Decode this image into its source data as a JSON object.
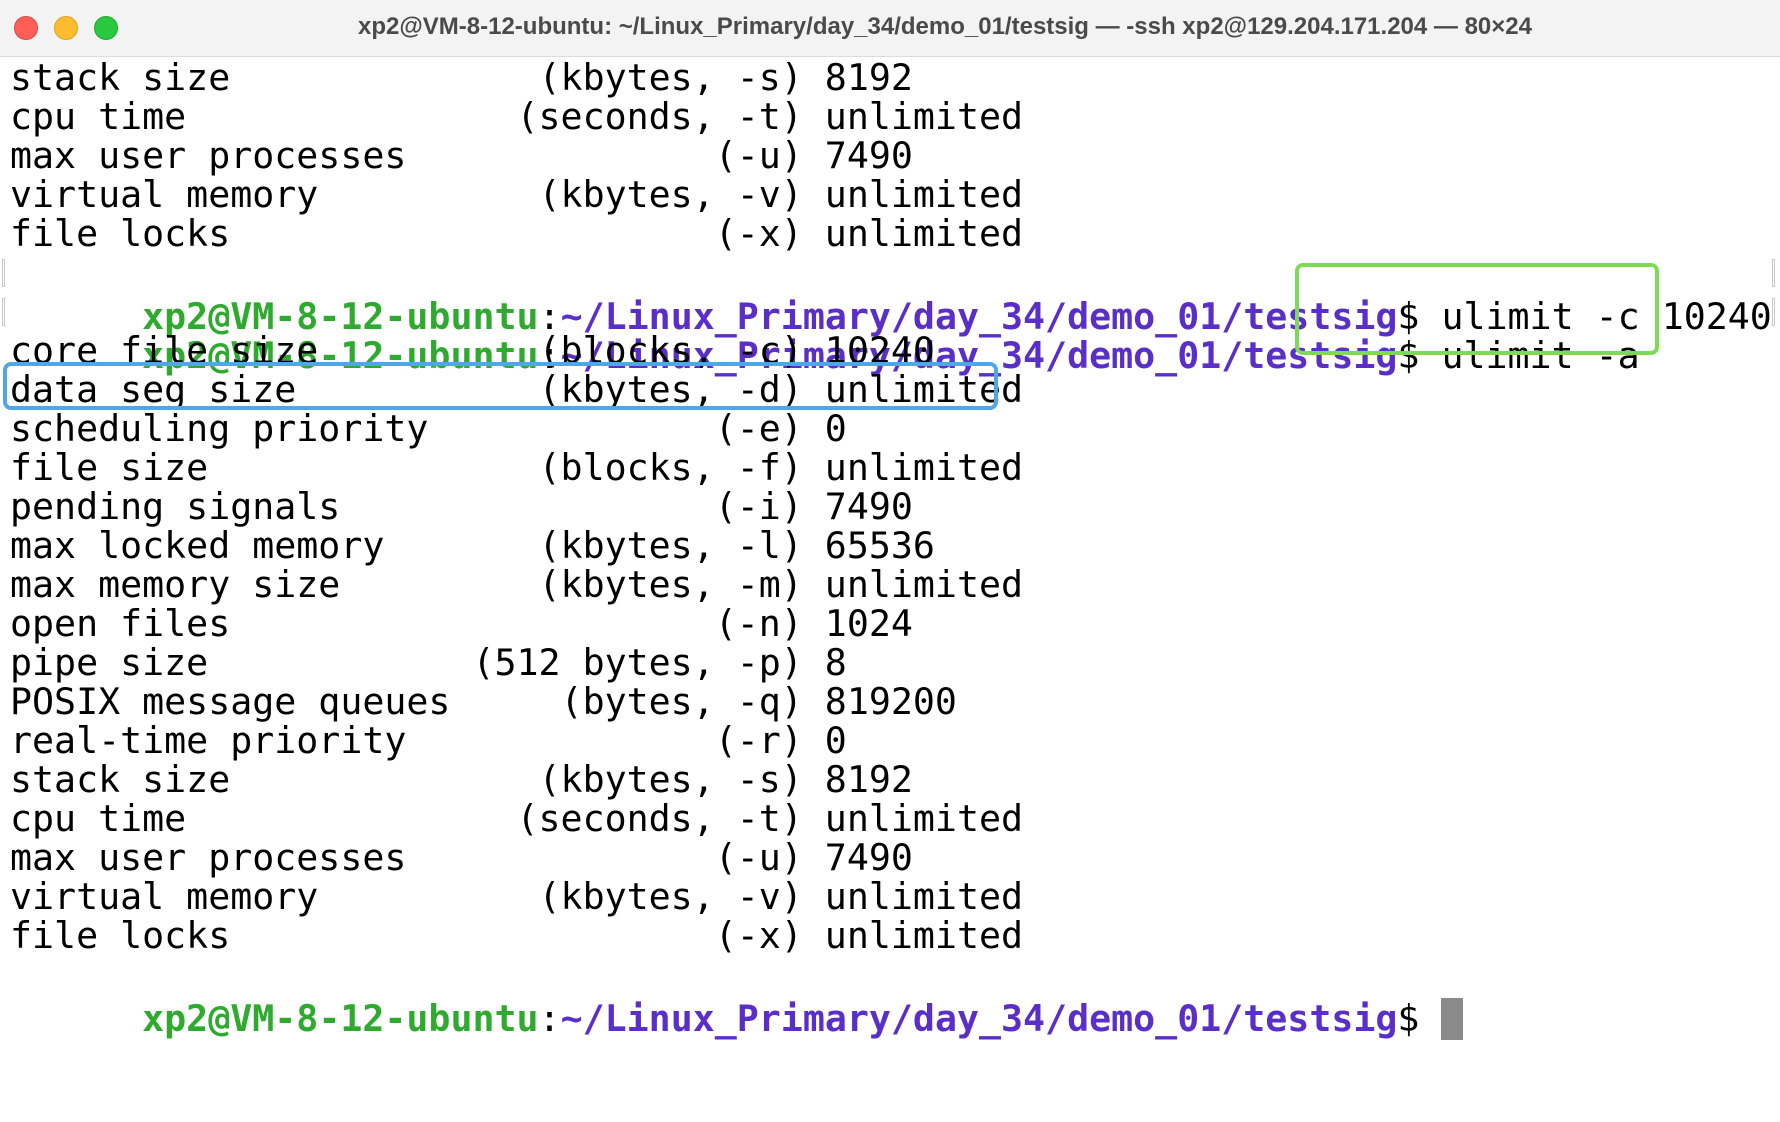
{
  "window": {
    "title": "xp2@VM-8-12-ubuntu: ~/Linux_Primary/day_34/demo_01/testsig — -ssh xp2@129.204.171.204 — 80×24"
  },
  "terminal": {
    "prompt_user": "xp2@VM-8-12-ubuntu",
    "prompt_colon": ":",
    "prompt_path": "~/Linux_Primary/day_34/demo_01/testsig",
    "prompt_symbol": "$ ",
    "output_top": [
      "stack size              (kbytes, -s) 8192",
      "cpu time               (seconds, -t) unlimited",
      "max user processes              (-u) 7490",
      "virtual memory          (kbytes, -v) unlimited",
      "file locks                      (-x) unlimited"
    ],
    "commands": [
      "ulimit -c 10240",
      "ulimit -a"
    ],
    "output_bottom": [
      "core file size          (blocks, -c) 10240",
      "data seg size           (kbytes, -d) unlimited",
      "scheduling priority             (-e) 0",
      "file size               (blocks, -f) unlimited",
      "pending signals                 (-i) 7490",
      "max locked memory       (kbytes, -l) 65536",
      "max memory size         (kbytes, -m) unlimited",
      "open files                      (-n) 1024",
      "pipe size            (512 bytes, -p) 8",
      "POSIX message queues     (bytes, -q) 819200",
      "real-time priority              (-r) 0",
      "stack size              (kbytes, -s) 8192",
      "cpu time               (seconds, -t) unlimited",
      "max user processes              (-u) 7490",
      "virtual memory          (kbytes, -v) unlimited",
      "file locks                      (-x) unlimited"
    ]
  },
  "colors": {
    "prompt_user": "#2eaa2e",
    "prompt_path": "#5a2ec8",
    "highlight_command_box": "#7ed957",
    "highlight_output_box": "#4ea8e8",
    "cursor": "#8a8a8a"
  },
  "icons": {
    "close": "close-traffic-light-icon",
    "minimize": "minimize-traffic-light-icon",
    "maximize": "maximize-traffic-light-icon"
  }
}
